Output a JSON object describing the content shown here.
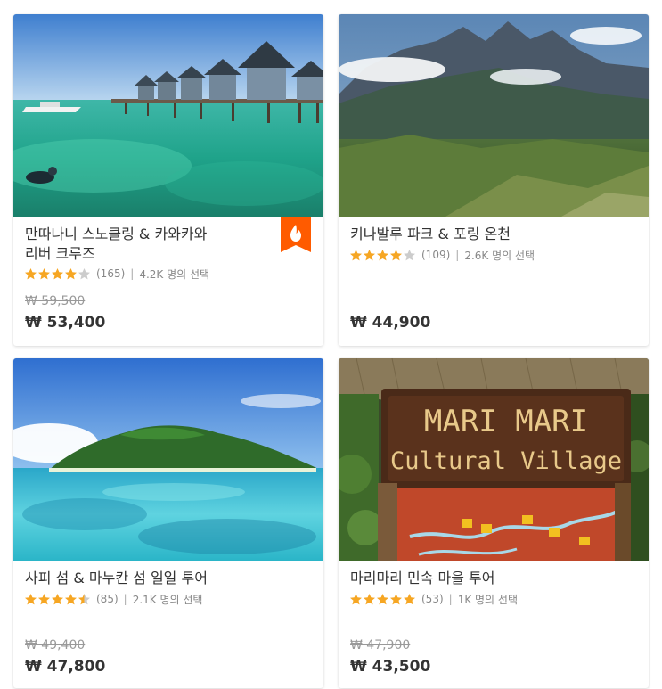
{
  "colors": {
    "star": "#f6a623",
    "star_empty": "#cccccc",
    "badge": "#ff5b00"
  },
  "cards": [
    {
      "image": "water-villa-snorkeling-photo",
      "title_lines": [
        "만따나니 스노클링 & 카와카와",
        "리버 크루즈"
      ],
      "rating": 4.0,
      "reviews": "(165)",
      "chosen": "4.2K 명의 선택",
      "price_old": "₩ 59,500",
      "price_now": "₩ 53,400",
      "hot": true
    },
    {
      "image": "mountain-kinabalu-photo",
      "title_lines": [
        "키나발루 파크 & 포링 온천"
      ],
      "rating": 4.0,
      "reviews": "(109)",
      "chosen": "2.6K 명의 선택",
      "price_old": "",
      "price_now": "₩ 44,900",
      "hot": false
    },
    {
      "image": "island-lagoon-photo",
      "title_lines": [
        "사피 섬 & 마누칸 섬 일일 투어"
      ],
      "rating": 4.5,
      "reviews": "(85)",
      "chosen": "2.1K 명의 선택",
      "price_old": "₩ 49,400",
      "price_now": "₩ 47,800",
      "hot": false
    },
    {
      "image": "mari-mari-village-sign-photo",
      "title_lines": [
        "마리마리 민속 마을 투어"
      ],
      "rating": 5.0,
      "reviews": "(53)",
      "chosen": "1K 명의 선택",
      "price_old": "₩ 47,900",
      "price_now": "₩ 43,500",
      "hot": false
    }
  ],
  "sign": {
    "line1": "MARI MARI",
    "line2": "Cultural Village"
  }
}
